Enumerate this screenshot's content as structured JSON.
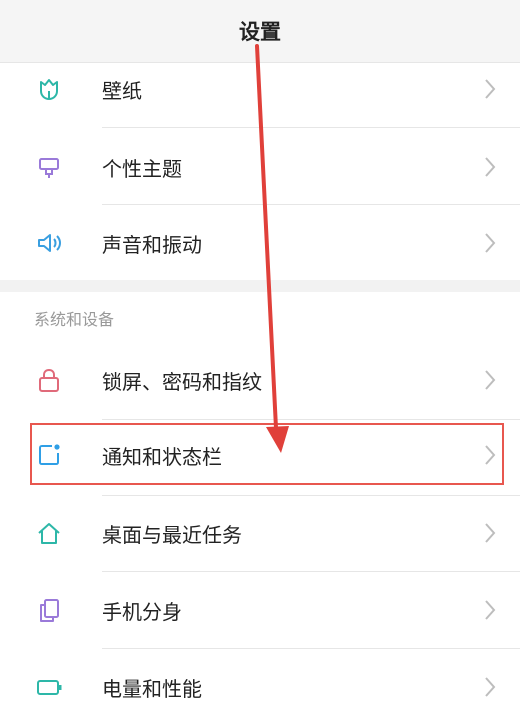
{
  "header": {
    "title": "设置"
  },
  "section_top": {
    "items": [
      {
        "label": "壁纸",
        "icon": "wallpaper-tulip-icon",
        "color": "#2db7a8"
      },
      {
        "label": "个性主题",
        "icon": "theme-brush-icon",
        "color": "#9a7ad9"
      },
      {
        "label": "声音和振动",
        "icon": "speaker-icon",
        "color": "#3a9fe0"
      }
    ]
  },
  "section_system": {
    "title": "系统和设备",
    "items": [
      {
        "label": "锁屏、密码和指纹",
        "icon": "lock-icon",
        "color": "#e06a7a"
      },
      {
        "label": "通知和状态栏",
        "icon": "notification-icon",
        "color": "#2f9fe6"
      },
      {
        "label": "桌面与最近任务",
        "icon": "home-icon",
        "color": "#2db7a8"
      },
      {
        "label": "手机分身",
        "icon": "phone-clone-icon",
        "color": "#9a7ad9"
      },
      {
        "label": "电量和性能",
        "icon": "battery-icon",
        "color": "#2db7a8"
      }
    ]
  },
  "annotation": {
    "highlight_color": "#e8574f",
    "arrow_color": "#e0403a"
  }
}
